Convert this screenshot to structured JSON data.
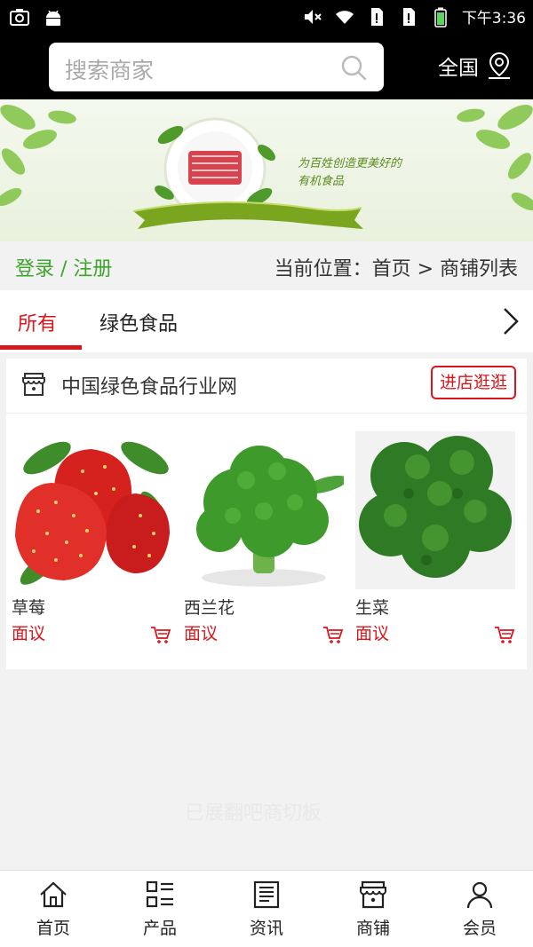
{
  "status_bar": {
    "time": "下午3:36"
  },
  "header": {
    "search_placeholder": "搜索商家",
    "region": "全国"
  },
  "banner": {
    "slogan_line1": "为百姓创造更美好的",
    "slogan_line2": "有机食品"
  },
  "breadcrumb": {
    "login": "登录 / 注册",
    "location": "当前位置：首页 > 商铺列表"
  },
  "tabs": [
    {
      "label": "所有",
      "active": true
    },
    {
      "label": "绿色食品",
      "active": false
    }
  ],
  "shop": {
    "name": "中国绿色食品行业网",
    "visit_label": "进店逛逛",
    "products": [
      {
        "name": "草莓",
        "price": "面议",
        "image": "strawberry"
      },
      {
        "name": "西兰花",
        "price": "面议",
        "image": "broccoli"
      },
      {
        "name": "生菜",
        "price": "面议",
        "image": "lettuce"
      }
    ]
  },
  "watermark": "已展翻吧商切板",
  "bottom_nav": [
    {
      "label": "首页",
      "icon": "home-icon"
    },
    {
      "label": "产品",
      "icon": "grid-list-icon"
    },
    {
      "label": "资讯",
      "icon": "news-icon"
    },
    {
      "label": "商铺",
      "icon": "shop-icon"
    },
    {
      "label": "会员",
      "icon": "user-icon"
    }
  ],
  "colors": {
    "accent": "#d9161d",
    "login_green": "#3da42c",
    "header_bg": "#000000"
  }
}
